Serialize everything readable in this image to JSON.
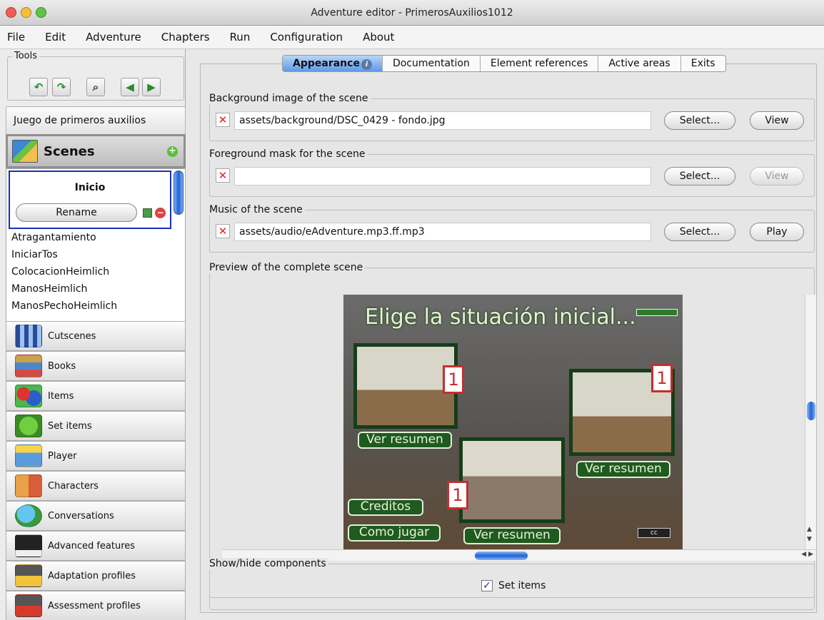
{
  "window": {
    "title": "Adventure editor - PrimerosAuxilios1012"
  },
  "menubar": [
    "File",
    "Edit",
    "Adventure",
    "Chapters",
    "Run",
    "Configuration",
    "About"
  ],
  "tools": {
    "label": "Tools"
  },
  "project": {
    "name": "Juego de primeros auxilios"
  },
  "scenes": {
    "label": "Scenes",
    "selected": {
      "name": "Inicio",
      "rename_label": "Rename"
    },
    "items": [
      "Atragantamiento",
      "IniciarTos",
      "ColocacionHeimlich",
      "ManosHeimlich",
      "ManosPechoHeimlich"
    ]
  },
  "categories": [
    {
      "label": "Cutscenes",
      "icon": "film-icon"
    },
    {
      "label": "Books",
      "icon": "books-icon"
    },
    {
      "label": "Items",
      "icon": "items-icon"
    },
    {
      "label": "Set items",
      "icon": "tree-icon"
    },
    {
      "label": "Player",
      "icon": "player-icon"
    },
    {
      "label": "Characters",
      "icon": "characters-icon"
    },
    {
      "label": "Conversations",
      "icon": "speech-bubble-icon"
    },
    {
      "label": "Advanced features",
      "icon": "magic-hat-icon"
    },
    {
      "label": "Adaptation profiles",
      "icon": "adaptation-icon"
    },
    {
      "label": "Assessment profiles",
      "icon": "assessment-icon"
    }
  ],
  "tabs": [
    "Appearance",
    "Documentation",
    "Element references",
    "Active areas",
    "Exits"
  ],
  "background": {
    "label": "Background image of the scene",
    "path": "assets/background/DSC_0429 - fondo.jpg",
    "select": "Select...",
    "view": "View"
  },
  "foreground": {
    "label": "Foreground mask for the scene",
    "path": "",
    "select": "Select...",
    "view": "View"
  },
  "music": {
    "label": "Music of the scene",
    "path": "assets/audio/eAdventure.mp3.ff.mp3",
    "select": "Select...",
    "play": "Play"
  },
  "preview": {
    "label": "Preview of the complete scene",
    "title": "Elige la situación inicial...",
    "thumb_number": "1",
    "resumen": "Ver resumen",
    "creditos": "Creditos",
    "como_jugar": "Como jugar"
  },
  "components": {
    "label": "Show/hide components",
    "set_items": "Set items",
    "checked": true
  },
  "colors": {
    "accent_tab": "#5f9ae6",
    "selection_border": "#1c2fb5",
    "preview_green": "#1f5a1f",
    "remove_red": "#d22222"
  }
}
